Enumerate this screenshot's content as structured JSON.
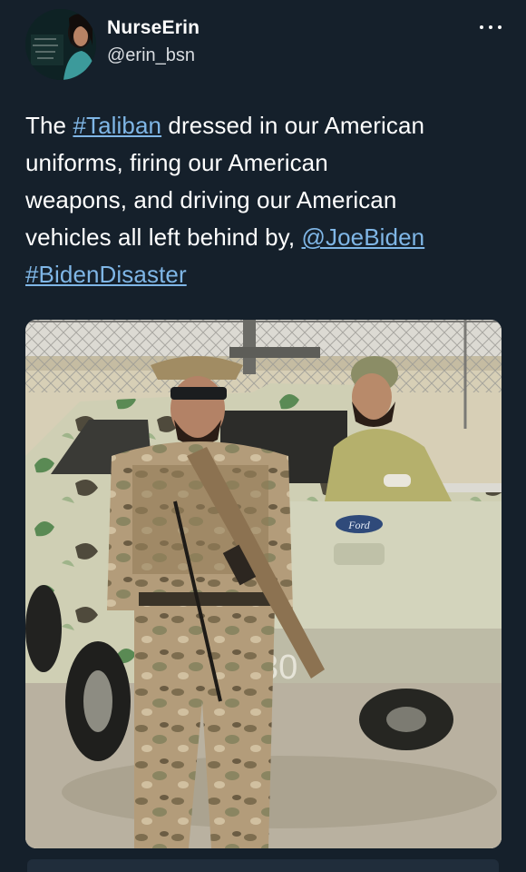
{
  "tweet": {
    "author": {
      "name": "NurseErin",
      "handle": "@erin_bsn",
      "avatar_icon": "profile-photo-avatar"
    },
    "more_icon": "more-options-icon",
    "text": {
      "line1_pre": "The ",
      "line1_link": "#Taliban",
      "line1_post": " dressed in our American",
      "line2": "uniforms, firing our American",
      "line3": "weapons, and driving our American",
      "line4_pre": "vehicles all left behind by, ",
      "line4_link": "@JoeBiden",
      "line5_link": "#BidenDisaster"
    },
    "media": {
      "vehicle_badge": "Ford",
      "vehicle_number": "30"
    }
  },
  "colors": {
    "background": "#15202b",
    "link": "#7fb6e6",
    "text": "#ffffff",
    "secondary_text": "#d9dde1"
  }
}
